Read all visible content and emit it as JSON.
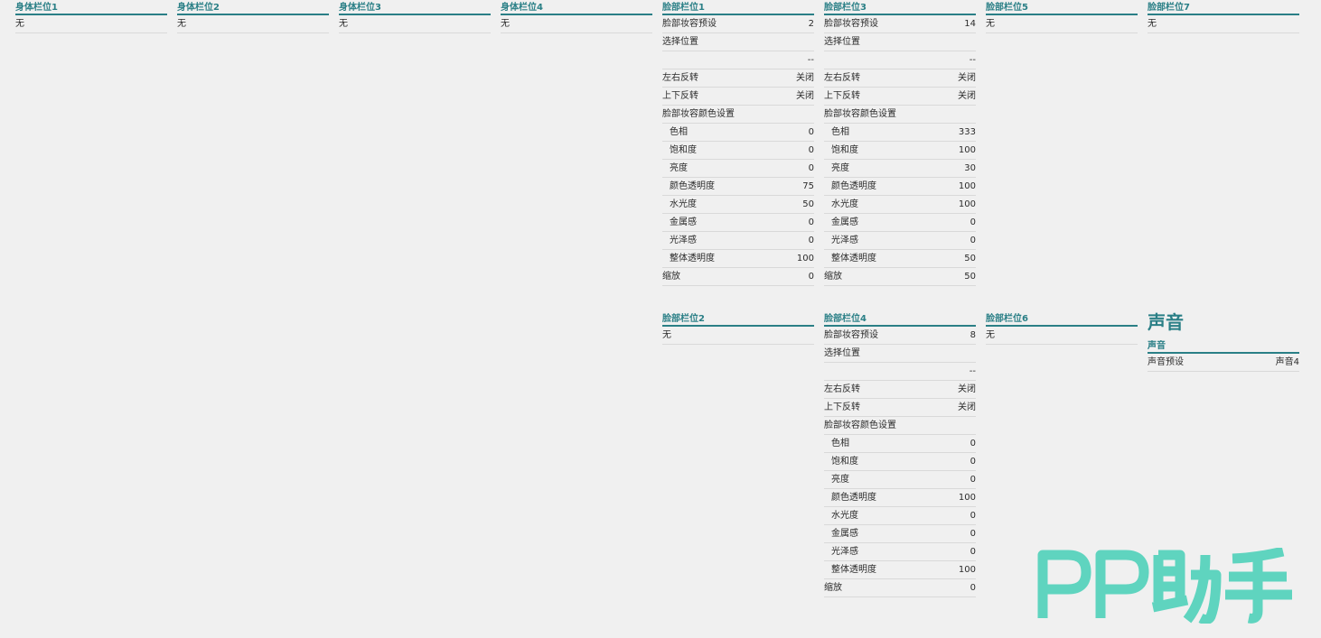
{
  "columns": {
    "body1": {
      "header": "身体栏位1",
      "rows": [
        {
          "label": "无",
          "value": ""
        }
      ]
    },
    "body2": {
      "header": "身体栏位2",
      "rows": [
        {
          "label": "无",
          "value": ""
        }
      ]
    },
    "body3": {
      "header": "身体栏位3",
      "rows": [
        {
          "label": "无",
          "value": ""
        }
      ]
    },
    "body4": {
      "header": "身体栏位4",
      "rows": [
        {
          "label": "无",
          "value": ""
        }
      ]
    },
    "face1": {
      "header": "脸部栏位1",
      "rows": [
        {
          "label": "脸部妆容预设",
          "value": "2"
        },
        {
          "label": "选择位置",
          "value": ""
        },
        {
          "label": "",
          "value": "--"
        },
        {
          "label": "左右反转",
          "value": "关闭"
        },
        {
          "label": "上下反转",
          "value": "关闭"
        },
        {
          "label": "脸部妆容颜色设置",
          "value": ""
        },
        {
          "label": "色相",
          "value": "0",
          "indent": true
        },
        {
          "label": "饱和度",
          "value": "0",
          "indent": true
        },
        {
          "label": "亮度",
          "value": "0",
          "indent": true
        },
        {
          "label": "颜色透明度",
          "value": "75",
          "indent": true
        },
        {
          "label": "水光度",
          "value": "50",
          "indent": true
        },
        {
          "label": "金属感",
          "value": "0",
          "indent": true
        },
        {
          "label": "光泽感",
          "value": "0",
          "indent": true
        },
        {
          "label": "整体透明度",
          "value": "100",
          "indent": true
        },
        {
          "label": "缩放",
          "value": "0"
        }
      ]
    },
    "face3": {
      "header": "脸部栏位3",
      "rows": [
        {
          "label": "脸部妆容预设",
          "value": "14"
        },
        {
          "label": "选择位置",
          "value": ""
        },
        {
          "label": "",
          "value": "--"
        },
        {
          "label": "左右反转",
          "value": "关闭"
        },
        {
          "label": "上下反转",
          "value": "关闭"
        },
        {
          "label": "脸部妆容颜色设置",
          "value": ""
        },
        {
          "label": "色相",
          "value": "333",
          "indent": true
        },
        {
          "label": "饱和度",
          "value": "100",
          "indent": true
        },
        {
          "label": "亮度",
          "value": "30",
          "indent": true
        },
        {
          "label": "颜色透明度",
          "value": "100",
          "indent": true
        },
        {
          "label": "水光度",
          "value": "100",
          "indent": true
        },
        {
          "label": "金属感",
          "value": "0",
          "indent": true
        },
        {
          "label": "光泽感",
          "value": "0",
          "indent": true
        },
        {
          "label": "整体透明度",
          "value": "50",
          "indent": true
        },
        {
          "label": "缩放",
          "value": "50"
        }
      ]
    },
    "face5": {
      "header": "脸部栏位5",
      "rows": [
        {
          "label": "无",
          "value": ""
        }
      ]
    },
    "face7": {
      "header": "脸部栏位7",
      "rows": [
        {
          "label": "无",
          "value": ""
        }
      ]
    },
    "face2": {
      "header": "脸部栏位2",
      "rows": [
        {
          "label": "无",
          "value": ""
        }
      ]
    },
    "face4": {
      "header": "脸部栏位4",
      "rows": [
        {
          "label": "脸部妆容预设",
          "value": "8"
        },
        {
          "label": "选择位置",
          "value": ""
        },
        {
          "label": "",
          "value": "--"
        },
        {
          "label": "左右反转",
          "value": "关闭"
        },
        {
          "label": "上下反转",
          "value": "关闭"
        },
        {
          "label": "脸部妆容颜色设置",
          "value": ""
        },
        {
          "label": "色相",
          "value": "0",
          "indent": true
        },
        {
          "label": "饱和度",
          "value": "0",
          "indent": true
        },
        {
          "label": "亮度",
          "value": "0",
          "indent": true
        },
        {
          "label": "颜色透明度",
          "value": "100",
          "indent": true
        },
        {
          "label": "水光度",
          "value": "0",
          "indent": true
        },
        {
          "label": "金属感",
          "value": "0",
          "indent": true
        },
        {
          "label": "光泽感",
          "value": "0",
          "indent": true
        },
        {
          "label": "整体透明度",
          "value": "100",
          "indent": true
        },
        {
          "label": "缩放",
          "value": "0"
        }
      ]
    },
    "face6": {
      "header": "脸部栏位6",
      "rows": [
        {
          "label": "无",
          "value": ""
        }
      ]
    },
    "sound": {
      "header": "声音",
      "rows": [
        {
          "label": "声音预设",
          "value": "声音4"
        }
      ]
    }
  },
  "sound_section_title": "声音",
  "watermark": {
    "text": "PP助手",
    "color": "#5fd4bf"
  },
  "colors": {
    "accent": "#2a7f86",
    "background": "#f0f0f0",
    "divider": "#d9d9d9"
  }
}
